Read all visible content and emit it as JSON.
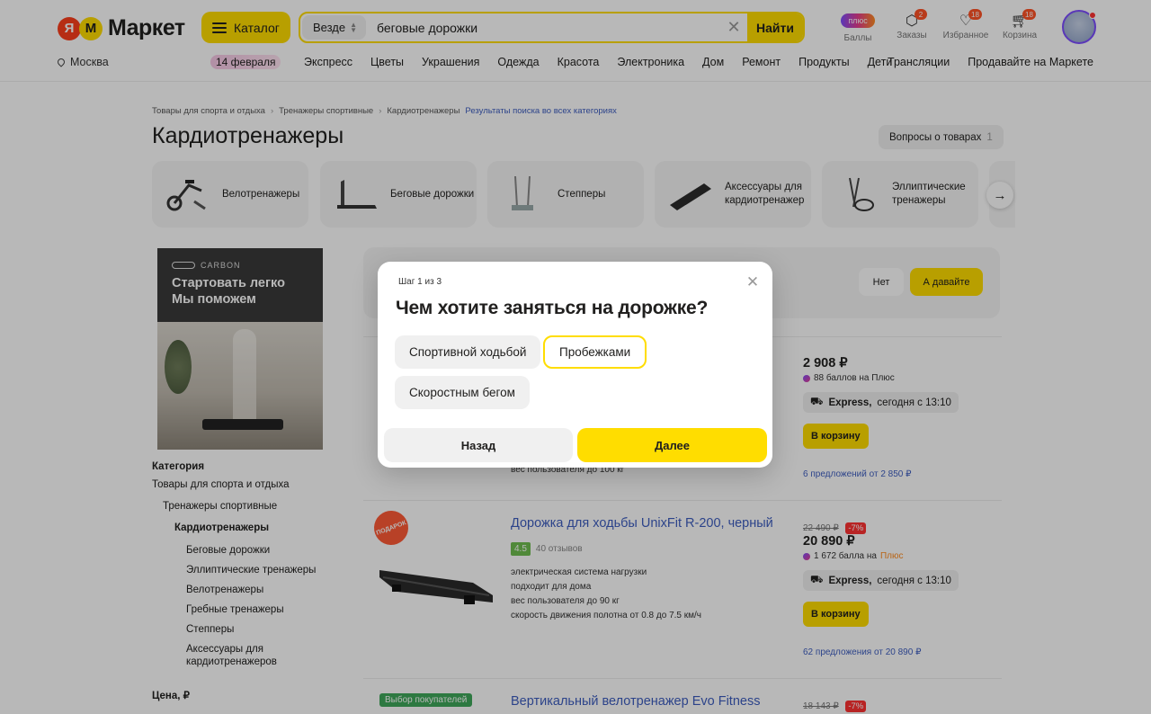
{
  "header": {
    "logo_ya": "Я",
    "logo_m": "М",
    "logo_text": "Маркет",
    "catalog_label": "Каталог",
    "search_scope": "Везде",
    "search_value": "беговые дорожки",
    "search_button": "Найти",
    "icons": [
      {
        "name": "plus-icon",
        "label": "Баллы",
        "pill": "плюс"
      },
      {
        "name": "orders-icon",
        "label": "Заказы",
        "badge": "2"
      },
      {
        "name": "favorites-icon",
        "label": "Избранное",
        "badge": "18"
      },
      {
        "name": "cart-icon",
        "label": "Корзина",
        "badge": "18"
      }
    ]
  },
  "subnav": {
    "city": "Москва",
    "date_pill": "14 февраля",
    "categories": [
      "Экспресс",
      "Цветы",
      "Украшения",
      "Одежда",
      "Красота",
      "Электроника",
      "Дом",
      "Ремонт",
      "Продукты",
      "Дети"
    ],
    "right_links": [
      "Трансляции",
      "Продавайте на Маркете"
    ]
  },
  "breadcrumbs": [
    "Товары для спорта и отдыха",
    "Тренажеры спортивные",
    "Кардиотренажеры"
  ],
  "breadcrumb_highlight": "Результаты поиска во всех категориях",
  "page_title": "Кардиотренажеры",
  "questions_button": {
    "label": "Вопросы о товарах",
    "count": "1"
  },
  "category_tiles": [
    {
      "label": "Велотренажеры"
    },
    {
      "label": "Беговые дорожки"
    },
    {
      "label": "Степперы"
    },
    {
      "label": "Аксессуары для кардиотренажер"
    },
    {
      "label": "Эллиптические тренажеры"
    }
  ],
  "banner": {
    "brand": "CARBON",
    "title_line1": "Стартовать легко",
    "title_line2": "Мы поможем"
  },
  "sidebar": {
    "heading": "Категория",
    "level0": "Товары для спорта и отдыха",
    "level1": "Тренажеры спортивные",
    "level2": "Кардиотренажеры",
    "level3": [
      "Беговые дорожки",
      "Эллиптические тренажеры",
      "Велотренажеры",
      "Гребные тренажеры",
      "Степперы",
      "Аксессуары для кардиотренажеров"
    ],
    "price_heading": "Цена, ₽"
  },
  "quiz_bar": {
    "no": "Нет",
    "yes": "А давайте"
  },
  "products": [
    {
      "title": "",
      "spec_tail": "вес пользователя до 100 кг",
      "price": "2 908 ₽",
      "plus_points": "88 баллов на Плюс",
      "express_bold": "Express,",
      "express_rest": "сегодня с 13:10",
      "cart": "В корзину",
      "offers": "6 предложений от 2 850 ₽"
    },
    {
      "badge": "ПОДАРОК",
      "title": "Дорожка для ходьбы UnixFit R-200, черный",
      "rating": "4.5",
      "reviews": "40 отзывов",
      "specs": [
        "электрическая система нагрузки",
        "подходит для дома",
        "вес пользователя до 90 кг",
        "скорость движения полотна от 0.8 до 7.5 км/ч"
      ],
      "old_price": "22 490 ₽",
      "discount": "-7%",
      "price": "20 890 ₽",
      "plus_points_prefix": "1 672 балла на",
      "plus_word": "Плюс",
      "express_bold": "Express,",
      "express_rest": "сегодня с 13:10",
      "cart": "В корзину",
      "offers": "62 предложения от 20 890 ₽"
    },
    {
      "badge": "Выбор покупателей",
      "title": "Вертикальный велотренажер Evo Fitness",
      "old_price": "18 143 ₽",
      "discount": "-7%"
    }
  ],
  "modal": {
    "step": "Шаг 1 из 3",
    "title": "Чем хотите заняться на дорожке?",
    "options": [
      "Спортивной ходьбой",
      "Пробежками",
      "Скоростным бегом"
    ],
    "selected_option": "Пробежками",
    "back": "Назад",
    "next": "Далее"
  },
  "colors": {
    "accent_yellow": "#ffdd00",
    "link_blue": "#3e5ec0",
    "discount_red": "#ff3333",
    "rating_green": "#6fbe4f"
  }
}
